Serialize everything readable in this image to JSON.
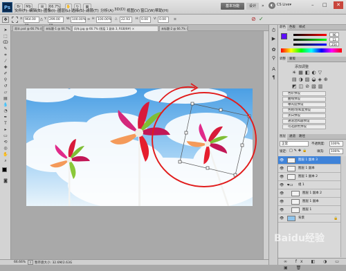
{
  "app": {
    "logo": "Ps",
    "bridge_label": "Br",
    "mini_bridge_label": "Mb",
    "zoom_select": "66.7%",
    "workspace_button": "基本功能",
    "design_button": "设计",
    "cslive_label": "CS Live▾"
  },
  "menu": [
    "文件(F)",
    "编辑(E)",
    "图像(I)",
    "图层(L)",
    "选择(S)",
    "滤镜(T)",
    "分析(A)",
    "3D(D)",
    "视图(V)",
    "窗口(W)",
    "帮助(H)"
  ],
  "options_bar": {
    "x_label": "X:",
    "x_value": "964.00 px",
    "y_label": "Y:",
    "y_value": "299.00 px",
    "w_label": "W:",
    "w_value": "100.00%",
    "h_label": "H:",
    "h_value": "100.00%",
    "angle_label": "△",
    "angle_value": "22.93",
    "hskew_label": "H:",
    "hskew_value": "0.00",
    "vskew_label": "V:",
    "vskew_value": "0.00"
  },
  "tabs": [
    {
      "label": "雨伞.psd @ 66.7% (图...",
      "active": false
    },
    {
      "label": "未标题-1 @ 66.7%...",
      "active": false
    },
    {
      "label": "风车.jpg @ 66.7% (图层 1 副本 3, RGB/8#) ×",
      "active": true
    },
    {
      "label": "未标题-2 @ 66.7% (..."
    }
  ],
  "status": {
    "zoom": "66.66%",
    "info": "暂存盘大小: 32.6M/2.63G"
  },
  "panels": {
    "color_tabs": [
      "颜色",
      "色板",
      "样式"
    ],
    "color_values": [
      "96",
      "13",
      "254"
    ],
    "adjust_tabs": [
      "调整",
      "蒙版"
    ],
    "adjust_title": "添加调整",
    "presets": [
      "色阶预设",
      "曲线预设",
      "曝光度预设",
      "色相/饱和度预设",
      "黑白预设",
      "通道混和器预设",
      "可选颜色预设"
    ],
    "layer_tabs": [
      "图层",
      "通道",
      "路径"
    ],
    "blend_mode": "正常",
    "opacity_label": "不透明度:",
    "opacity_value": "100%",
    "lock_label": "锁定:",
    "fill_label": "填充:",
    "fill_value": "100%",
    "layers": [
      {
        "name": "图层 1 副本 3",
        "selected": true
      },
      {
        "name": "图层 1 副本",
        "selected": false
      },
      {
        "name": "图层 1 副本 2",
        "selected": false
      },
      {
        "name": "组 1",
        "selected": false
      },
      {
        "name": "图层 1 副本 2",
        "selected": false
      },
      {
        "name": "图层 1 副本",
        "selected": false
      },
      {
        "name": "图层 1",
        "selected": false
      },
      {
        "name": "背景",
        "selected": false
      }
    ]
  },
  "watermark": "Baidu经验",
  "colors": {
    "selection": "#3f83d9",
    "annotation": "#e11d1d",
    "sky": "#5aa7e6"
  }
}
